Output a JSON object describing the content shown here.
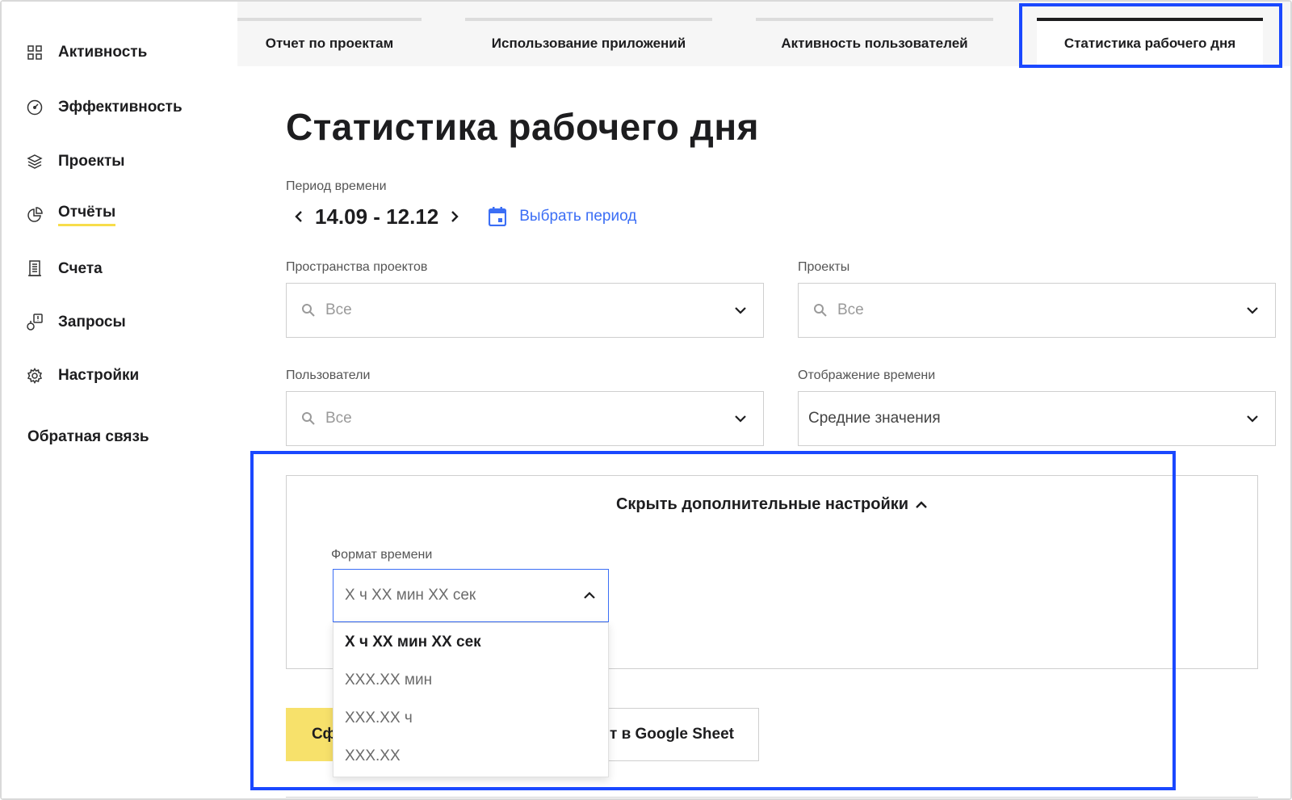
{
  "sidebar": {
    "items": [
      {
        "label": "Активность",
        "icon": "grid-icon"
      },
      {
        "label": "Эффективность",
        "icon": "gauge-icon"
      },
      {
        "label": "Проекты",
        "icon": "layers-icon"
      },
      {
        "label": "Отчёты",
        "icon": "pie-chart-icon",
        "active": true
      },
      {
        "label": "Счета",
        "icon": "receipt-icon"
      },
      {
        "label": "Запросы",
        "icon": "request-icon"
      },
      {
        "label": "Настройки",
        "icon": "gear-icon"
      }
    ],
    "feedback": "Обратная связь"
  },
  "tabs": [
    {
      "label": "Отчет по проектам"
    },
    {
      "label": "Использование приложений"
    },
    {
      "label": "Активность пользователей"
    },
    {
      "label": "Статистика рабочего дня",
      "active": true
    }
  ],
  "page": {
    "title": "Статистика рабочего дня",
    "period_label": "Период времени",
    "period_value": "14.09 - 12.12",
    "pick_period": "Выбрать период"
  },
  "filters": {
    "spaces": {
      "label": "Пространства проектов",
      "placeholder": "Все"
    },
    "projects": {
      "label": "Проекты",
      "placeholder": "Все"
    },
    "users": {
      "label": "Пользователи",
      "placeholder": "Все"
    },
    "time_display": {
      "label": "Отображение времени",
      "value": "Средние значения"
    }
  },
  "advanced": {
    "toggle_label": "Скрыть дополнительные настройки",
    "format_label": "Формат времени",
    "format_value": "Х ч ХХ мин ХХ сек",
    "options": [
      "Х ч ХХ мин ХХ сек",
      "ХХХ.ХХ мин",
      "ХХХ.ХХ ч",
      "ХХХ.ХХ"
    ]
  },
  "buttons": {
    "generate_partial": "Сф",
    "export_partial": "т в Google Sheet"
  },
  "colors": {
    "accent_yellow": "#f7e16b",
    "link_blue": "#3b6ef5",
    "highlight_blue": "#1a48ff"
  }
}
